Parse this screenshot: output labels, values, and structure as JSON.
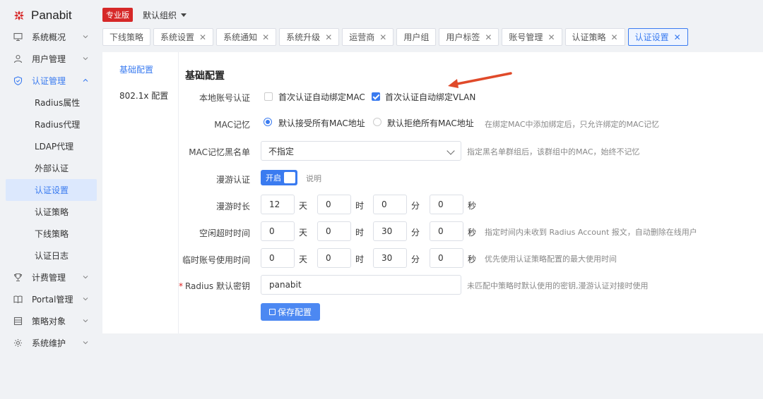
{
  "brand": {
    "name": "Panabit",
    "edition_badge": "专业版",
    "org_selector": "默认组织"
  },
  "sidebar": {
    "items": [
      {
        "label": "系统概况",
        "icon": "monitor-icon"
      },
      {
        "label": "用户管理",
        "icon": "user-icon"
      },
      {
        "label": "认证管理",
        "icon": "shield-icon",
        "expanded": true,
        "children": [
          "Radius属性",
          "Radius代理",
          "LDAP代理",
          "外部认证",
          "认证设置",
          "认证策略",
          "下线策略",
          "认证日志"
        ],
        "active_child": "认证设置"
      },
      {
        "label": "计费管理",
        "icon": "trophy-icon"
      },
      {
        "label": "Portal管理",
        "icon": "book-icon"
      },
      {
        "label": "策略对象",
        "icon": "list-icon"
      },
      {
        "label": "系统维护",
        "icon": "gear-icon"
      }
    ]
  },
  "tabs": [
    {
      "label": "下线策略",
      "closable": false
    },
    {
      "label": "系统设置",
      "closable": true
    },
    {
      "label": "系统通知",
      "closable": true
    },
    {
      "label": "系统升级",
      "closable": true
    },
    {
      "label": "运营商",
      "closable": true
    },
    {
      "label": "用户组",
      "closable": false
    },
    {
      "label": "用户标签",
      "closable": true
    },
    {
      "label": "账号管理",
      "closable": true
    },
    {
      "label": "认证策略",
      "closable": true
    },
    {
      "label": "认证设置",
      "closable": true,
      "active": true
    }
  ],
  "subnav": {
    "items": [
      "基础配置",
      "802.1x 配置"
    ],
    "active": "基础配置"
  },
  "form": {
    "section_title": "基础配置",
    "local_account": {
      "label": "本地账号认证",
      "opt_mac": {
        "text": "首次认证自动绑定MAC",
        "checked": false
      },
      "opt_vlan": {
        "text": "首次认证自动绑定VLAN",
        "checked": true
      }
    },
    "mac_memory": {
      "label": "MAC记忆",
      "opt_accept": {
        "text": "默认接受所有MAC地址",
        "checked": true
      },
      "opt_reject": {
        "text": "默认拒绝所有MAC地址",
        "checked": false
      },
      "hint": "在绑定MAC中添加绑定后，只允许绑定的MAC记忆"
    },
    "mac_blacklist": {
      "label": "MAC记忆黑名单",
      "value": "不指定",
      "hint": "指定黑名单群组后，该群组中的MAC，始终不记忆"
    },
    "roaming": {
      "label": "漫游认证",
      "toggle_text": "开启",
      "enabled": true,
      "link": "说明"
    },
    "roaming_duration": {
      "label": "漫游时长",
      "days": "12",
      "hours": "0",
      "minutes": "0",
      "seconds": "0"
    },
    "idle_timeout": {
      "label": "空闲超时时间",
      "days": "0",
      "hours": "0",
      "minutes": "30",
      "seconds": "0",
      "hint": "指定时间内未收到 Radius Account 报文，自动删除在线用户"
    },
    "temp_account": {
      "label": "临时账号使用时间",
      "days": "0",
      "hours": "0",
      "minutes": "30",
      "seconds": "0",
      "hint": "优先使用认证策略配置的最大使用时间"
    },
    "radius_secret": {
      "label": "Radius 默认密钥",
      "required_mark": "*",
      "value": "panabit",
      "hint": "未匹配中策略时默认使用的密钥,漫游认证对接时使用"
    },
    "units": {
      "day": "天",
      "hour": "时",
      "minute": "分",
      "second": "秒"
    },
    "save_label": "保存配置"
  },
  "colors": {
    "accent": "#3a7bf0",
    "badge": "#d62828",
    "annotation_arrow": "#e04a2a"
  }
}
